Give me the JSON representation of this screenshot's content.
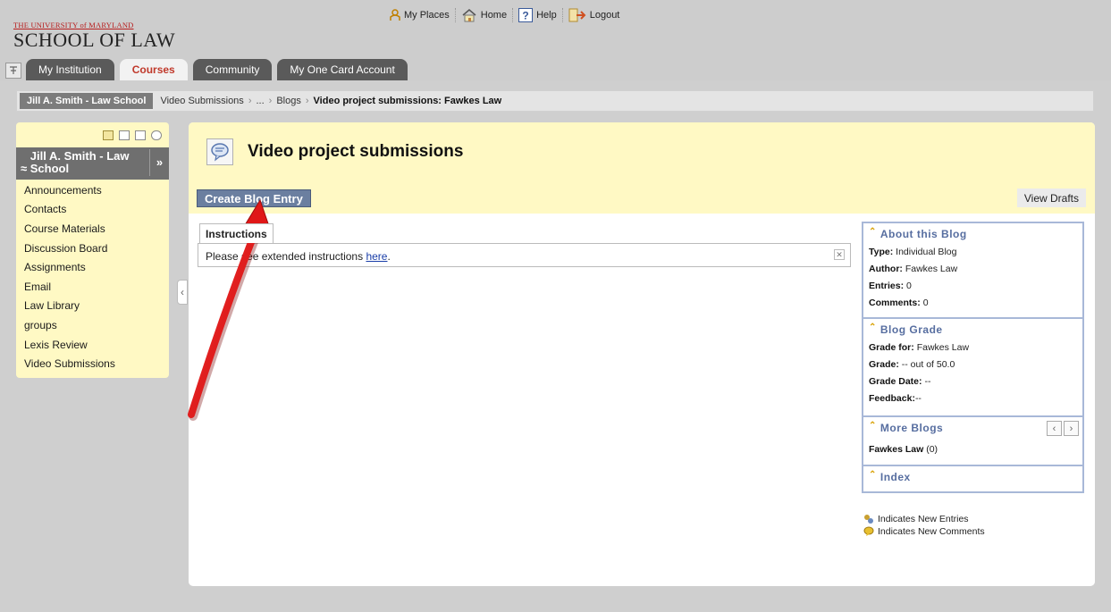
{
  "header": {
    "logo_small": "THE UNIVERSITY of MARYLAND",
    "logo_big": "SCHOOL OF LAW",
    "topnav": [
      {
        "label": "My Places",
        "icon": "person-icon"
      },
      {
        "label": "Home",
        "icon": "home-icon"
      },
      {
        "label": "Help",
        "icon": "help-icon"
      },
      {
        "label": "Logout",
        "icon": "logout-icon"
      }
    ],
    "tabs": [
      "My Institution",
      "Courses",
      "Community",
      "My One Card Account"
    ],
    "active_tab": "Courses"
  },
  "breadcrumb": {
    "home": "Jill A. Smith - Law School",
    "items": [
      "Video Submissions",
      "...",
      "Blogs"
    ],
    "current": "Video project submissions: Fawkes Law"
  },
  "menu": {
    "title": "Jill A. Smith - Law School",
    "items": [
      "Announcements",
      "Contacts",
      "Course Materials",
      "Discussion Board",
      "Assignments",
      "Email",
      "Law Library",
      "groups",
      "Lexis Review",
      "Video Submissions"
    ]
  },
  "content": {
    "title": "Video project submissions",
    "create_button": "Create Blog Entry",
    "drafts_button": "View Drafts",
    "instructions_tab": "Instructions",
    "instructions_text": "Please see extended instructions",
    "instructions_link": "here",
    "instructions_end": "."
  },
  "sidebar": {
    "about": {
      "title": "About this Blog",
      "type_label": "Type:",
      "type_value": "Individual Blog",
      "author_label": "Author:",
      "author_value": "Fawkes Law",
      "entries_label": "Entries:",
      "entries_value": "0",
      "comments_label": "Comments:",
      "comments_value": "0"
    },
    "grade": {
      "title": "Blog Grade",
      "for_label": "Grade for:",
      "for_value": "Fawkes Law",
      "grade_label": "Grade:",
      "grade_value": "-- out of 50.0",
      "date_label": "Grade Date:",
      "date_value": "--",
      "feedback_label": "Feedback:",
      "feedback_value": "--"
    },
    "more": {
      "title": "More Blogs",
      "blog_name": "Fawkes Law",
      "blog_count": "(0)"
    },
    "index": {
      "title": "Index"
    }
  },
  "legend": {
    "new_entries": "Indicates New Entries",
    "new_comments": "Indicates New Comments"
  },
  "colors": {
    "yellow_panel": "#fff9c4",
    "button_blue": "#6b7fa0",
    "annotation_arrow": "#e01818",
    "active_tab_text": "#c0392b"
  }
}
